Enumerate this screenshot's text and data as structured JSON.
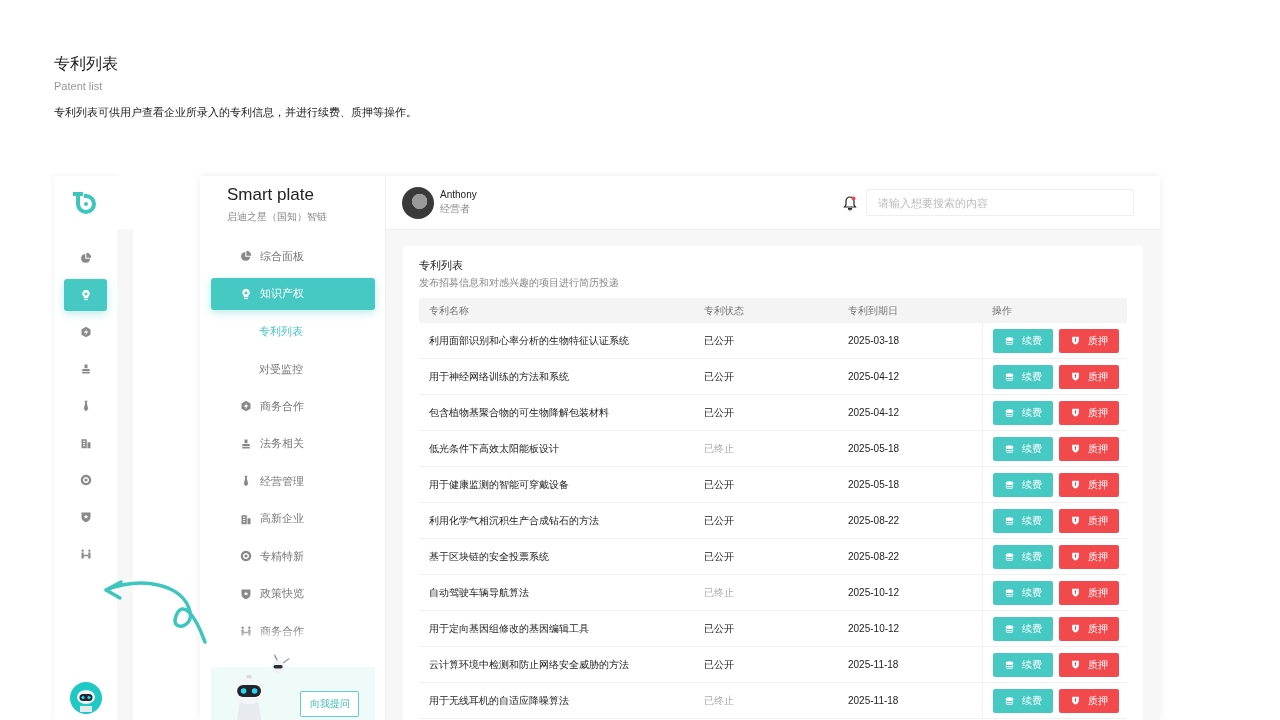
{
  "heading": {
    "title": "专利列表",
    "subtitle": "Patent list",
    "description": "专利列表可供用户查看企业所录入的专利信息，并进行续费、质押等操作。"
  },
  "rail": [
    {
      "kind": "pie",
      "selected": false
    },
    {
      "kind": "bulb",
      "selected": true
    },
    {
      "kind": "hex",
      "selected": false
    },
    {
      "kind": "stamp",
      "selected": false
    },
    {
      "kind": "tie",
      "selected": false
    },
    {
      "kind": "building",
      "selected": false
    },
    {
      "kind": "target",
      "selected": false
    },
    {
      "kind": "shield",
      "selected": false
    },
    {
      "kind": "people",
      "selected": false
    }
  ],
  "brand": {
    "name": "Smart plate",
    "tagline": "启迪之星（国知）智链"
  },
  "nav": [
    {
      "kind": "pie",
      "label": "综合面板",
      "selected": false
    },
    {
      "kind": "bulb",
      "label": "知识产权",
      "selected": true,
      "children": [
        {
          "label": "专利列表",
          "selected": true
        },
        {
          "label": "对受监控",
          "selected": false
        }
      ]
    },
    {
      "kind": "hex",
      "label": "商务合作",
      "selected": false
    },
    {
      "kind": "stamp",
      "label": "法务相关",
      "selected": false
    },
    {
      "kind": "tie",
      "label": "经营管理",
      "selected": false
    },
    {
      "kind": "building",
      "label": "高新企业",
      "selected": false
    },
    {
      "kind": "target",
      "label": "专精特新",
      "selected": false
    },
    {
      "kind": "shield",
      "label": "政策快览",
      "selected": false
    },
    {
      "kind": "people",
      "label": "商务合作",
      "selected": false
    }
  ],
  "assistant": {
    "button": "向我提问"
  },
  "user": {
    "name": "Anthony",
    "role": "经营者"
  },
  "notifications": {
    "unread": true
  },
  "search": {
    "placeholder": "请输入想要搜索的内容"
  },
  "card": {
    "title": "专利列表",
    "subtitle": "发布招募信息和对感兴趣的项目进行简历投递"
  },
  "table": {
    "columns": [
      "专利名称",
      "专利状态",
      "专利到期日",
      "操作"
    ],
    "rows": [
      {
        "name": "利用面部识别和心率分析的生物特征认证系统",
        "status": "已公开",
        "active": true,
        "date": "2025-03-18",
        "actions": [
          "续费",
          "质押"
        ]
      },
      {
        "name": "用于神经网络训练的方法和系统",
        "status": "已公开",
        "active": true,
        "date": "2025-04-12",
        "actions": [
          "续费",
          "质押"
        ]
      },
      {
        "name": "包含植物基聚合物的可生物降解包装材料",
        "status": "已公开",
        "active": true,
        "date": "2025-04-12",
        "actions": [
          "续费",
          "质押"
        ]
      },
      {
        "name": "低光条件下高效太阳能板设计",
        "status": "已终止",
        "active": false,
        "date": "2025-05-18",
        "actions": [
          "续费",
          "质押"
        ]
      },
      {
        "name": "用于健康监测的智能可穿戴设备",
        "status": "已公开",
        "active": true,
        "date": "2025-05-18",
        "actions": [
          "续费",
          "质押"
        ]
      },
      {
        "name": "利用化学气相沉积生产合成钻石的方法",
        "status": "已公开",
        "active": true,
        "date": "2025-08-22",
        "actions": [
          "续费",
          "质押"
        ]
      },
      {
        "name": "基于区块链的安全投票系统",
        "status": "已公开",
        "active": true,
        "date": "2025-08-22",
        "actions": [
          "续费",
          "质押"
        ]
      },
      {
        "name": "自动驾驶车辆导航算法",
        "status": "已终止",
        "active": false,
        "date": "2025-10-12",
        "actions": [
          "续费",
          "质押"
        ]
      },
      {
        "name": "用于定向基因组修改的基因编辑工具",
        "status": "已公开",
        "active": true,
        "date": "2025-10-12",
        "actions": [
          "续费",
          "质押"
        ]
      },
      {
        "name": "云计算环境中检测和防止网络安全威胁的方法",
        "status": "已公开",
        "active": true,
        "date": "2025-11-18",
        "actions": [
          "续费",
          "质押"
        ]
      },
      {
        "name": "用于无线耳机的自适应降噪算法",
        "status": "已终止",
        "active": false,
        "date": "2025-11-18",
        "actions": [
          "续费",
          "质押"
        ]
      }
    ]
  }
}
